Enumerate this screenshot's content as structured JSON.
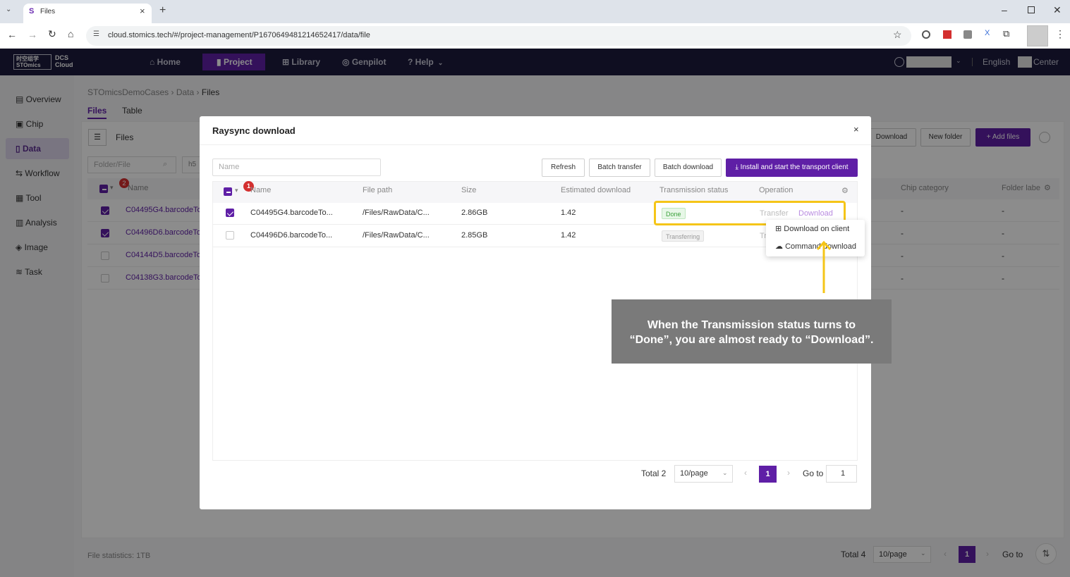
{
  "browser": {
    "tab_title": "Files",
    "url": "cloud.stomics.tech/#/project-management/P16706494812146524​17/data/file"
  },
  "header": {
    "logo_cn": "时空组学",
    "logo_en": "STOmics",
    "product_line1": "DCS",
    "product_line2": "Cloud",
    "nav": [
      "Home",
      "Project",
      "Library",
      "Genpilot",
      "Help"
    ],
    "language": "English",
    "center": "Center"
  },
  "sidebar": {
    "items": [
      "Overview",
      "Chip",
      "Data",
      "Workflow",
      "Tool",
      "Analysis",
      "Image",
      "Task"
    ]
  },
  "page": {
    "breadcrumb": [
      "STOmicsDemoCases",
      "Data",
      "Files"
    ],
    "tabs": [
      "Files",
      "Table"
    ],
    "files_label": "Files",
    "search_placeholder": "Folder/File",
    "h5_label": "h5",
    "name_header": "Name",
    "chip_category_header": "Chip category",
    "folder_label_header": "Folder labe",
    "buttons": {
      "download": "Download",
      "new_folder": "New folder",
      "add_files": "Add files"
    },
    "rows": [
      "C04495G4.barcodeTo",
      "C04496D6.barcodeTo",
      "C04144D5.barcodeTo",
      "C04138G3.barcodeTo"
    ],
    "dash": "-",
    "file_stats": "File statistics:  1TB",
    "total": "Total 4",
    "per_page": "10/page",
    "page_num": "1",
    "goto": "Go to",
    "badge": "2"
  },
  "modal": {
    "title": "Raysync download",
    "name_placeholder": "Name",
    "buttons": {
      "refresh": "Refresh",
      "batch_transfer": "Batch transfer",
      "batch_download": "Batch download",
      "install": "Install and start the transport client"
    },
    "columns": [
      "Name",
      "File path",
      "Size",
      "Estimated download",
      "Transmission status",
      "Operation"
    ],
    "rows": [
      {
        "name": "C04495G4.barcodeTo...",
        "path": "/Files/RawData/C...",
        "size": "2.86GB",
        "est": "1.42",
        "status": "Done",
        "checked": true
      },
      {
        "name": "C04496D6.barcodeTo...",
        "path": "/Files/RawData/C...",
        "size": "2.85GB",
        "est": "1.42",
        "status": "Transferring",
        "checked": false
      }
    ],
    "op_transfer": "Transfer",
    "op_download": "Download",
    "op_transfer_short": "Tr",
    "dropdown": [
      "Download on client",
      "Command download"
    ],
    "badge": "1",
    "total": "Total 2",
    "per_page": "10/page",
    "page_num": "1",
    "goto": "Go to",
    "goto_value": "1"
  },
  "callout": {
    "line1": "When the Transmission status turns to",
    "line2": "“Done”, you are almost ready to “Download”."
  },
  "colors": {
    "accent": "#5f1fa6",
    "highlight": "#f5c518",
    "header_bg": "#1c1b3d"
  }
}
